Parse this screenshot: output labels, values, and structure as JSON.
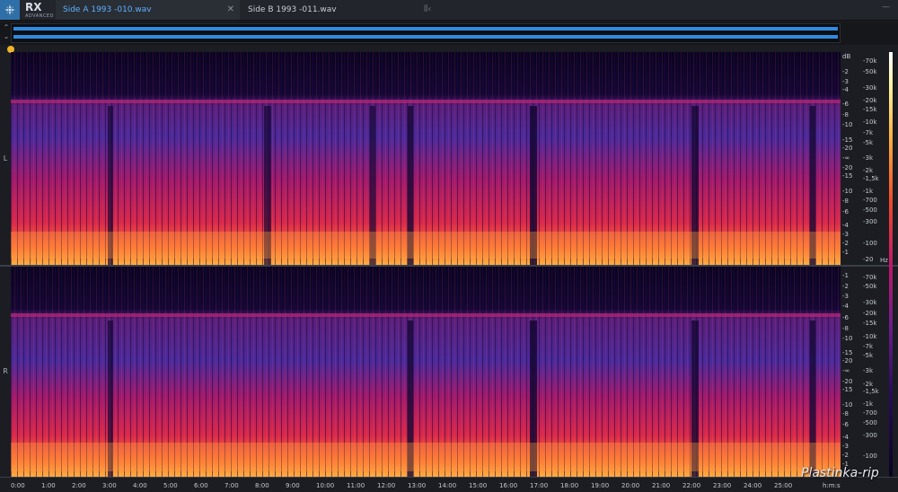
{
  "app": {
    "logo_text": "RX",
    "logo_subtext": "ADVANCED"
  },
  "tabs": [
    {
      "label": "Side A 1993 -010.wav",
      "active": true
    },
    {
      "label": "Side B 1993 -011.wav",
      "active": false
    }
  ],
  "colors": {
    "active_tab_text": "#5fb0ff",
    "waveform": "#2f8be0",
    "playhead": "#f0b429"
  },
  "channels": [
    {
      "label": "L",
      "db_labels": [
        "dB",
        "-2",
        "-3",
        "-4",
        "-6",
        "-8",
        "-10",
        "-15",
        "-20",
        "-∞",
        "-20",
        "-15",
        "-10",
        "-8",
        "-6",
        "-4",
        "-3",
        "-2",
        "-1"
      ],
      "hz_labels": [
        "-70k",
        "-50k",
        "-30k",
        "-20k",
        "-15k",
        "-10k",
        "-7k",
        "-5k",
        "-3k",
        "-2k",
        "-1,5k",
        "-1k",
        "-700",
        "-500",
        "-300",
        "-100",
        "-20"
      ]
    },
    {
      "label": "R",
      "db_labels": [
        "-1",
        "-2",
        "-3",
        "-4",
        "-6",
        "-8",
        "-10",
        "-15",
        "-20",
        "-∞",
        "-20",
        "-15",
        "-10",
        "-8",
        "-6",
        "-4",
        "-3",
        "-2",
        "-1"
      ],
      "hz_labels": [
        "-70k",
        "-50k",
        "-30k",
        "-20k",
        "-15k",
        "-10k",
        "-7k",
        "-5k",
        "-3k",
        "-2k",
        "-1,5k",
        "-1k",
        "-700",
        "-500",
        "-300",
        "-100"
      ]
    }
  ],
  "hz_unit": "Hz",
  "timeline": {
    "labels": [
      "0:00",
      "1:00",
      "2:00",
      "3:00",
      "4:00",
      "5:00",
      "6:00",
      "7:00",
      "8:00",
      "9:00",
      "10:00",
      "11:00",
      "12:00",
      "13:00",
      "14:00",
      "15:00",
      "16:00",
      "17:00",
      "18:00",
      "19:00",
      "20:00",
      "21:00",
      "22:00",
      "23:00",
      "24:00",
      "25:00",
      "h:m:s"
    ]
  },
  "watermark": "Plastinka-rip"
}
